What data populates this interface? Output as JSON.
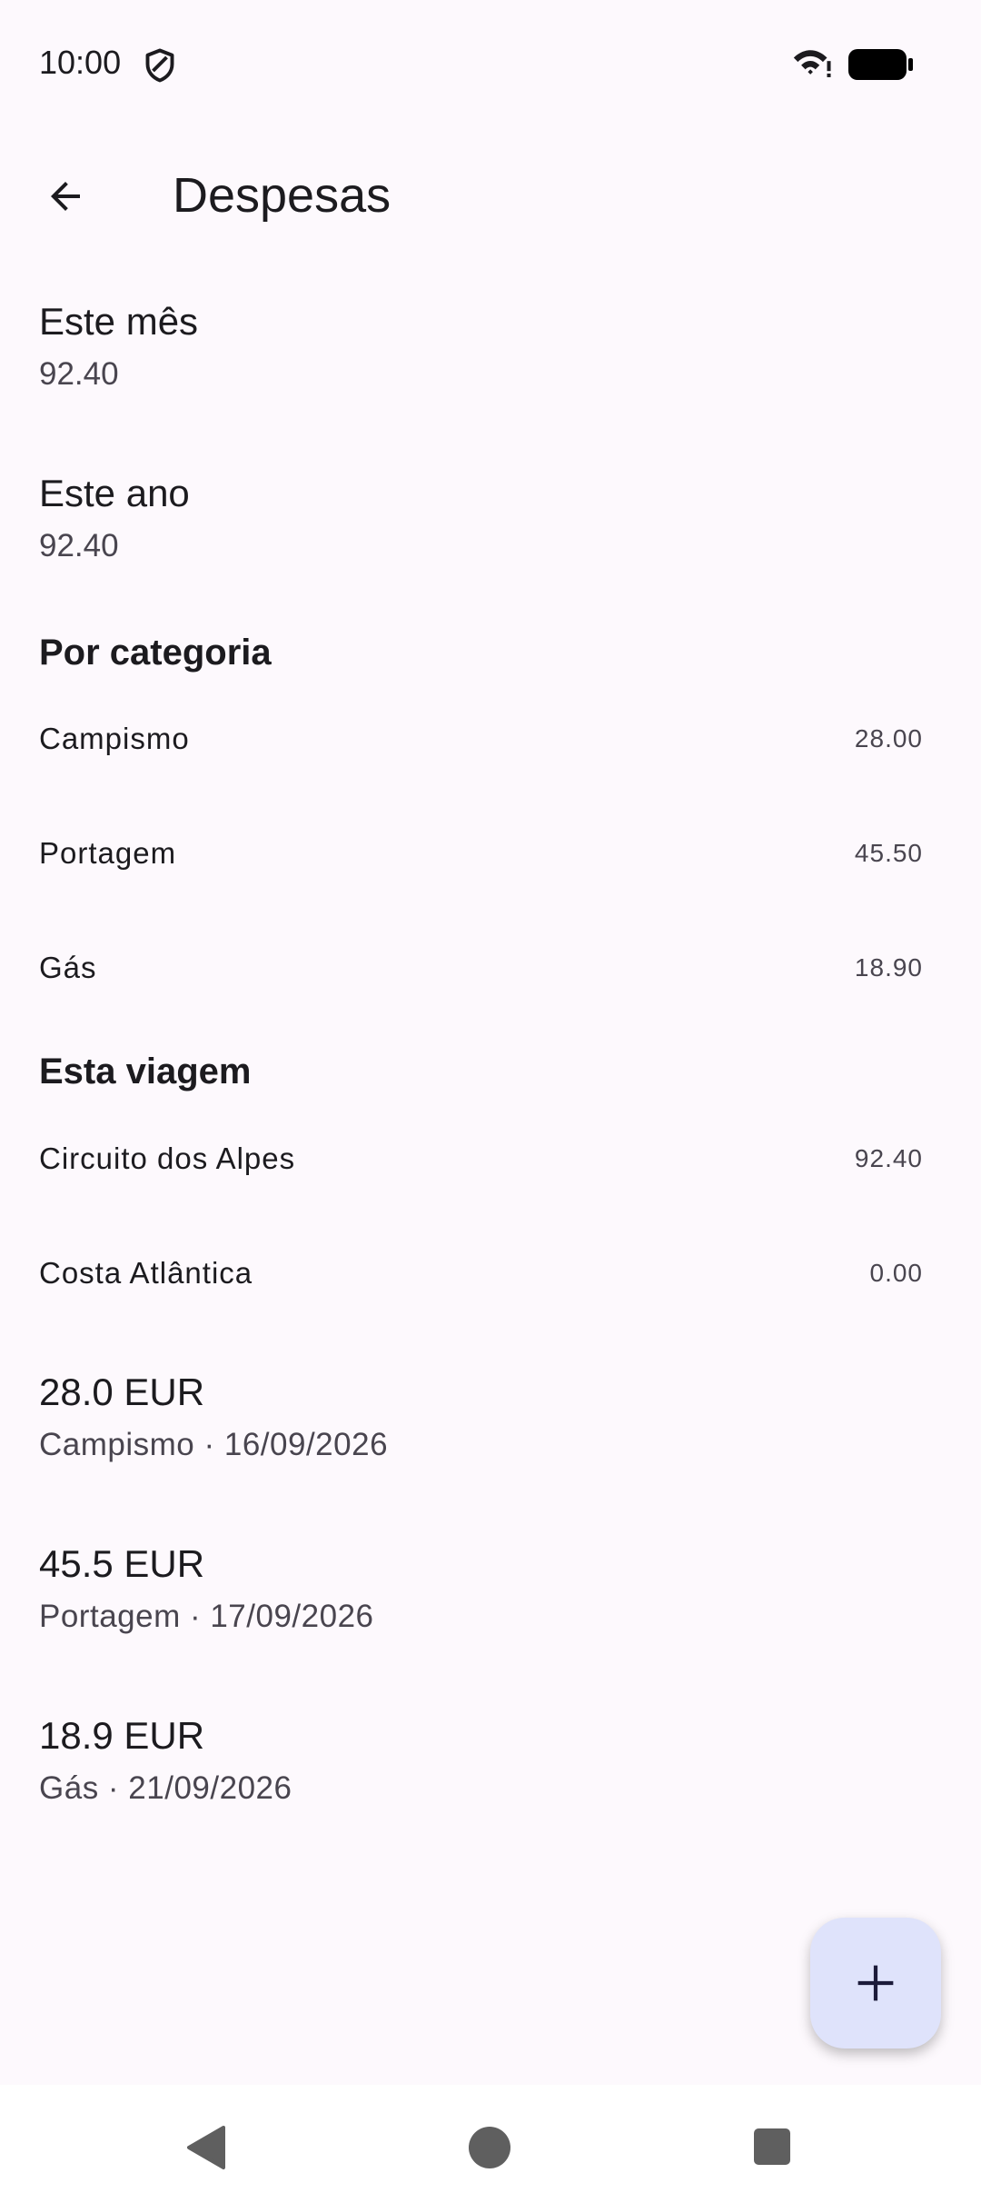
{
  "status_bar": {
    "time": "10:00",
    "icons": [
      "shield-icon",
      "wifi-icon",
      "battery-icon"
    ]
  },
  "app_bar": {
    "title": "Despesas",
    "back_icon": "arrow-back-icon"
  },
  "summary": {
    "month": {
      "label": "Este mês",
      "value": "92.40"
    },
    "year": {
      "label": "Este ano",
      "value": "92.40"
    }
  },
  "by_category": {
    "header": "Por categoria",
    "items": [
      {
        "name": "Campismo",
        "amount": "28.00"
      },
      {
        "name": "Portagem",
        "amount": "45.50"
      },
      {
        "name": "Gás",
        "amount": "18.90"
      }
    ]
  },
  "this_trip": {
    "header": "Esta viagem",
    "items": [
      {
        "name": "Circuito dos Alpes",
        "amount": "92.40"
      },
      {
        "name": "Costa Atlântica",
        "amount": "0.00"
      }
    ]
  },
  "expenses": [
    {
      "amount": "28.0 EUR",
      "meta": "Campismo · 16/09/2026"
    },
    {
      "amount": "45.5 EUR",
      "meta": "Portagem · 17/09/2026"
    },
    {
      "amount": "18.9 EUR",
      "meta": "Gás · 21/09/2026"
    }
  ],
  "fab": {
    "icon": "plus-icon"
  },
  "colors": {
    "background": "#fdf9fd",
    "fab": "#dfe3fb",
    "text_primary": "#1c1b1f",
    "text_secondary": "#49454f"
  }
}
